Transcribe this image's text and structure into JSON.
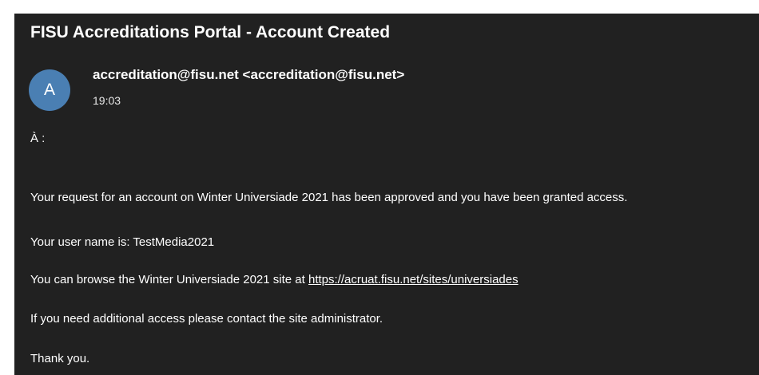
{
  "email": {
    "subject": "FISU Accreditations Portal - Account Created",
    "avatar_initial": "A",
    "sender": "accreditation@fisu.net <accreditation@fisu.net>",
    "time": "19:03",
    "to_label": "À :",
    "body": {
      "line1": "Your request for an account on Winter Universiade 2021 has been approved and you have been granted access.",
      "line2": "Your user name is: TestMedia2021",
      "line3_prefix": "You can browse the Winter Universiade 2021 site at ",
      "line3_link": "https://acruat.fisu.net/sites/universiades",
      "line4": "If you need additional access please contact the site administrator.",
      "line5": "Thank you."
    }
  },
  "colors": {
    "background": "#212121",
    "avatar": "#4a7fb3",
    "text": "#ffffff"
  }
}
